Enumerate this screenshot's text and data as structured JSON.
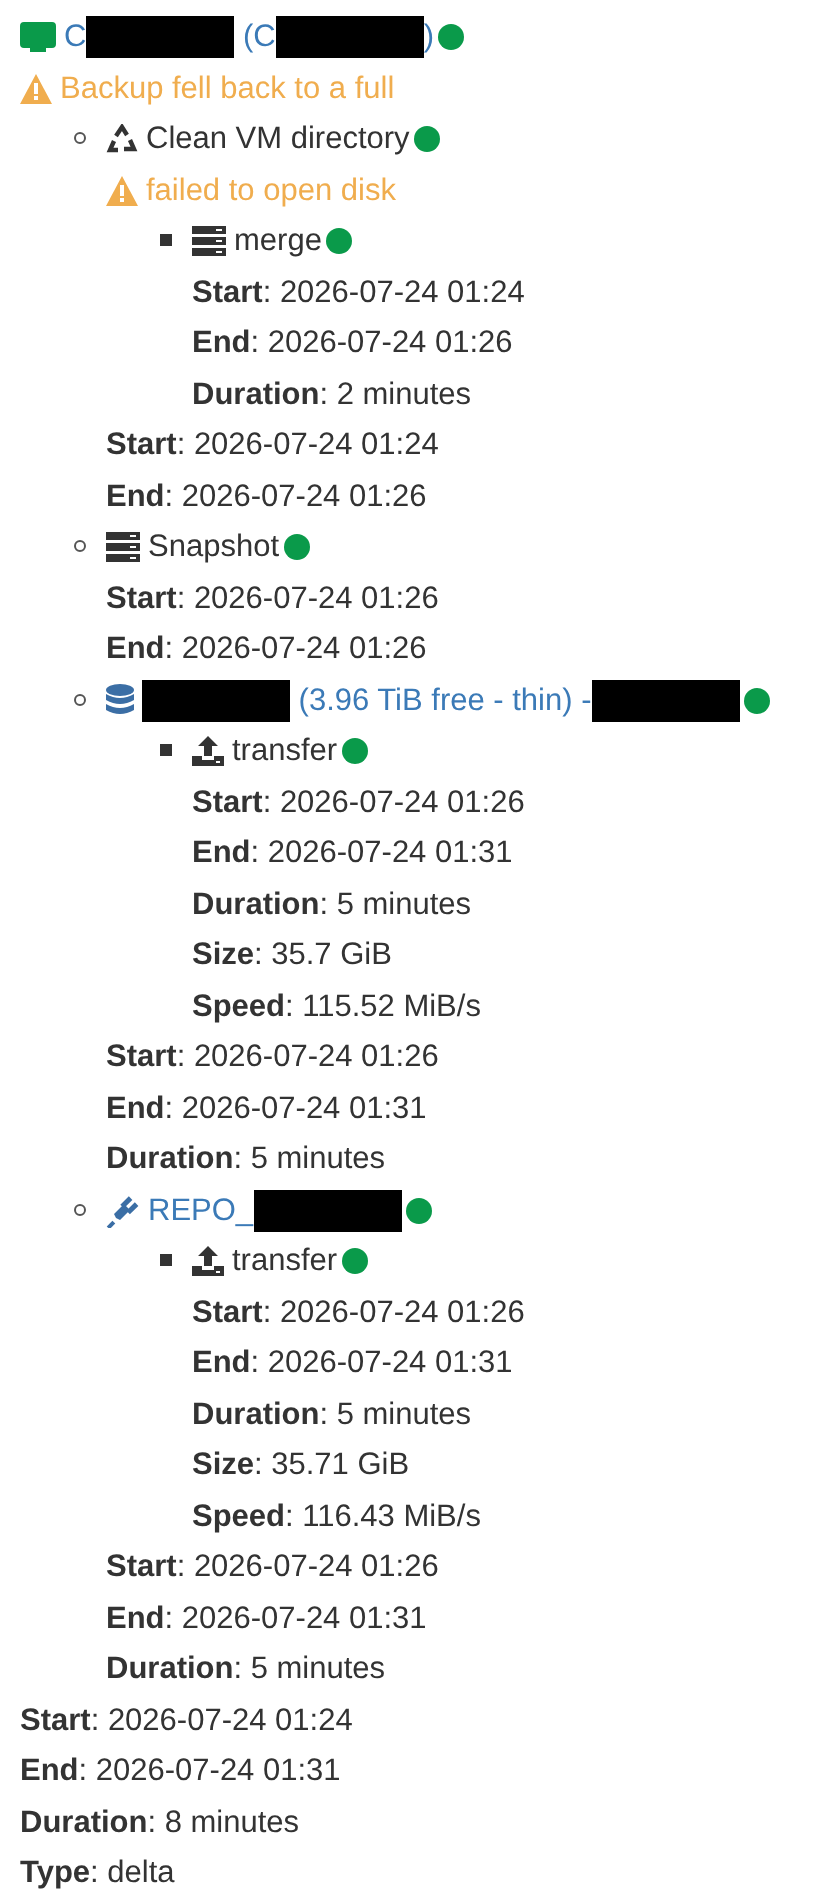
{
  "job": {
    "kind": "vm",
    "link": true,
    "color": "#0a9a4a",
    "title": [
      {
        "kind": "text",
        "text": "C"
      },
      {
        "kind": "redacted"
      },
      {
        "kind": "text",
        "text": " (C"
      },
      {
        "kind": "redacted"
      },
      {
        "kind": "text",
        "text": ")"
      }
    ],
    "warnings": [
      "Backup fell back to a full"
    ],
    "children": [
      {
        "kind": "recycle",
        "link": false,
        "color": "#0a9a4a",
        "title": [
          {
            "kind": "text",
            "text": "Clean VM directory"
          }
        ],
        "warnings": [
          "failed to open disk"
        ],
        "children": [
          {
            "kind": "server",
            "link": false,
            "color": "#0a9a4a",
            "title": [
              {
                "kind": "text",
                "text": "merge"
              }
            ],
            "details": [
              "**Start**: 2026-07-24 01:24",
              "**End**: 2026-07-24 01:26",
              "**Duration**: 2 minutes"
            ]
          }
        ],
        "details": [
          "**Start**: 2026-07-24 01:24",
          "**End**: 2026-07-24 01:26"
        ]
      },
      {
        "kind": "server",
        "link": false,
        "color": "#0a9a4a",
        "title": [
          {
            "kind": "text",
            "text": "Snapshot"
          }
        ],
        "details": [
          "**Start**: 2026-07-24 01:26",
          "**End**: 2026-07-24 01:26"
        ]
      },
      {
        "kind": "database",
        "link": true,
        "color": "#0a9a4a",
        "title": [
          {
            "kind": "redacted"
          },
          {
            "kind": "text",
            "text": " (3.96 TiB free - thin) -"
          },
          {
            "kind": "redacted"
          }
        ],
        "children": [
          {
            "kind": "upload",
            "link": false,
            "color": "#0a9a4a",
            "title": [
              {
                "kind": "text",
                "text": "transfer"
              }
            ],
            "details": [
              "**Start**: 2026-07-24 01:26",
              "**End**: 2026-07-24 01:31",
              "**Duration**: 5 minutes",
              "**Size**: 35.7 GiB",
              "**Speed**: 115.52 MiB/s"
            ]
          }
        ],
        "details": [
          "**Start**: 2026-07-24 01:26",
          "**End**: 2026-07-24 01:31",
          "**Duration**: 5 minutes"
        ]
      },
      {
        "kind": "plug",
        "link": true,
        "color": "#0a9a4a",
        "title": [
          {
            "kind": "text",
            "text": "REPO_"
          },
          {
            "kind": "redacted"
          }
        ],
        "children": [
          {
            "kind": "upload",
            "link": false,
            "color": "#0a9a4a",
            "title": [
              {
                "kind": "text",
                "text": "transfer"
              }
            ],
            "details": [
              "**Start**: 2026-07-24 01:26",
              "**End**: 2026-07-24 01:31",
              "**Duration**: 5 minutes",
              "**Size**: 35.71 GiB",
              "**Speed**: 116.43 MiB/s"
            ]
          }
        ],
        "details": [
          "**Start**: 2026-07-24 01:26",
          "**End**: 2026-07-24 01:31",
          "**Duration**: 5 minutes"
        ]
      }
    ],
    "details": [
      "**Start**: 2026-07-24 01:24",
      "**End**: 2026-07-24 01:31",
      "**Duration**: 8 minutes",
      "**Type**: delta"
    ]
  }
}
